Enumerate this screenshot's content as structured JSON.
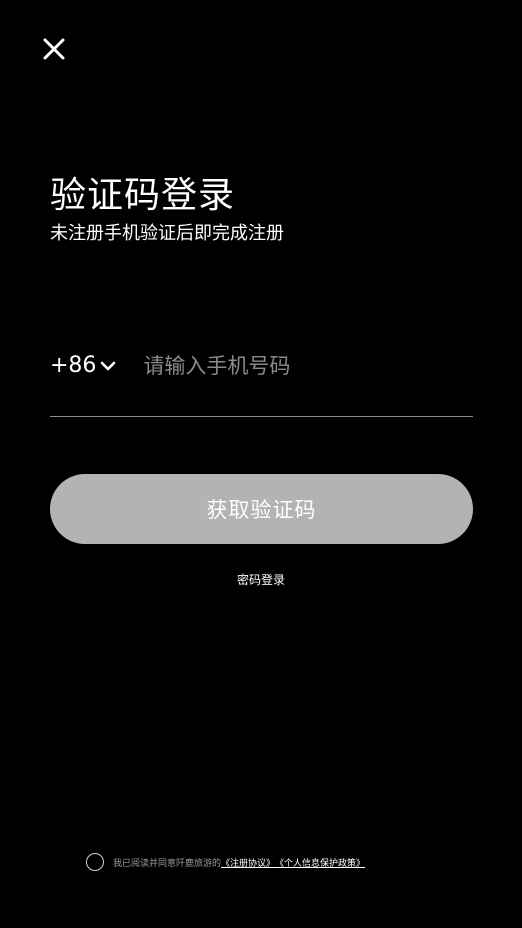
{
  "header": {
    "close_icon": "close-icon"
  },
  "login": {
    "title": "验证码登录",
    "subtitle": "未注册手机验证后即完成注册",
    "country_code": "+86",
    "country_chevron_icon": "chevron-down-icon",
    "phone_placeholder": "请输入手机号码",
    "phone_value": "",
    "get_code_label": "获取验证码",
    "password_login_label": "密码登录"
  },
  "agreement": {
    "checked": false,
    "prefix_text": "我已阅读并同意阡鹿旅游的",
    "terms_link": "《注册协议》",
    "privacy_link": "《个人信息保护政策》"
  },
  "colors": {
    "background": "#000000",
    "text": "#ffffff",
    "placeholder": "#8a8a8a",
    "button_disabled": "#b3b3b3",
    "divider": "#8c8c8c"
  }
}
